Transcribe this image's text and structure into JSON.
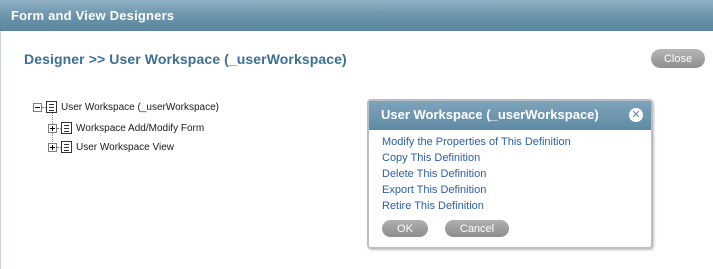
{
  "title_bar": {
    "title": "Form and View Designers"
  },
  "heading": "Designer >> User Workspace (_userWorkspace)",
  "close_button": "Close",
  "tree": {
    "root": {
      "label": "User Workspace (_userWorkspace)",
      "expanded": true
    },
    "children": [
      {
        "label": "Workspace Add/Modify Form",
        "expanded": false
      },
      {
        "label": "User Workspace View",
        "expanded": false
      }
    ]
  },
  "popup": {
    "title": "User Workspace (_userWorkspace)",
    "close_glyph": "✕",
    "links": [
      "Modify the Properties of This Definition",
      "Copy This Definition",
      "Delete This Definition",
      "Export This Definition",
      "Retire This Definition"
    ],
    "ok_label": "OK",
    "cancel_label": "Cancel"
  },
  "colors": {
    "title_bar": "#6a93ab",
    "heading": "#3d6f92",
    "link": "#2b5fa8",
    "button": "#9e9e9e"
  }
}
